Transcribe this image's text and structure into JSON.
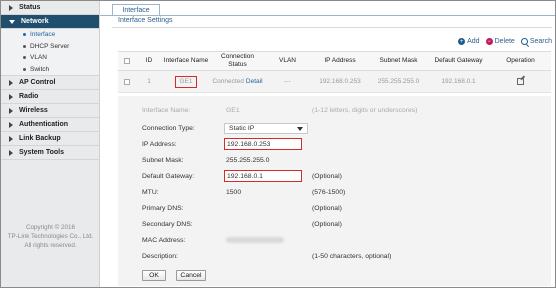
{
  "sidebar": {
    "items": [
      {
        "label": "Status"
      },
      {
        "label": "Network"
      },
      {
        "label": "AP Control"
      },
      {
        "label": "Radio"
      },
      {
        "label": "Wireless"
      },
      {
        "label": "Authentication"
      },
      {
        "label": "Link Backup"
      },
      {
        "label": "System Tools"
      }
    ],
    "network_sub": [
      {
        "label": "Interface"
      },
      {
        "label": "DHCP Server"
      },
      {
        "label": "VLAN"
      },
      {
        "label": "Switch"
      }
    ],
    "copyright": {
      "line1": "Copyright © 2016",
      "line2": "TP-Link Technologies Co., Ltd.",
      "line3": "All rights reserved."
    }
  },
  "tab": {
    "label": "Interface"
  },
  "subtitle": "Interface Settings",
  "actions": {
    "add": "Add",
    "delete": "Delete",
    "search": "Search"
  },
  "table": {
    "headers": {
      "id": "ID",
      "name": "Interface Name",
      "conn_line1": "Connection",
      "conn_line2": "Status",
      "vlan": "VLAN",
      "ip": "IP Address",
      "mask": "Subnet Mask",
      "gateway": "Default Gateway",
      "operation": "Operation"
    },
    "row": {
      "id": "1",
      "name": "GE1",
      "status": "Connected",
      "detail": "Detail",
      "vlan": "---",
      "ip": "192.168.0.253",
      "mask": "255.255.255.0",
      "gateway": "192.168.0.1"
    }
  },
  "form": {
    "name": {
      "label": "Interface Name:",
      "value": "GE1",
      "hint": "(1-12 letters, digits or underscores)"
    },
    "type": {
      "label": "Connection Type:",
      "value": "Static IP"
    },
    "ip": {
      "label": "IP Address:",
      "value": "192.168.0.253"
    },
    "mask": {
      "label": "Subnet Mask:",
      "value": "255.255.255.0"
    },
    "gateway": {
      "label": "Default Gateway:",
      "value": "192.168.0.1",
      "hint": "(Optional)"
    },
    "mtu": {
      "label": "MTU:",
      "value": "1500",
      "hint": "(576-1500)"
    },
    "dns1": {
      "label": "Primary DNS:",
      "hint": "(Optional)"
    },
    "dns2": {
      "label": "Secondary DNS:",
      "hint": "(Optional)"
    },
    "mac": {
      "label": "MAC Address:"
    },
    "desc": {
      "label": "Description:",
      "hint": "(1-50 characters, optional)"
    },
    "ok": "OK",
    "cancel": "Cancel"
  },
  "colors": {
    "accent": "#1f4f6d",
    "link": "#2465a5",
    "highlight": "#d62a2a"
  }
}
